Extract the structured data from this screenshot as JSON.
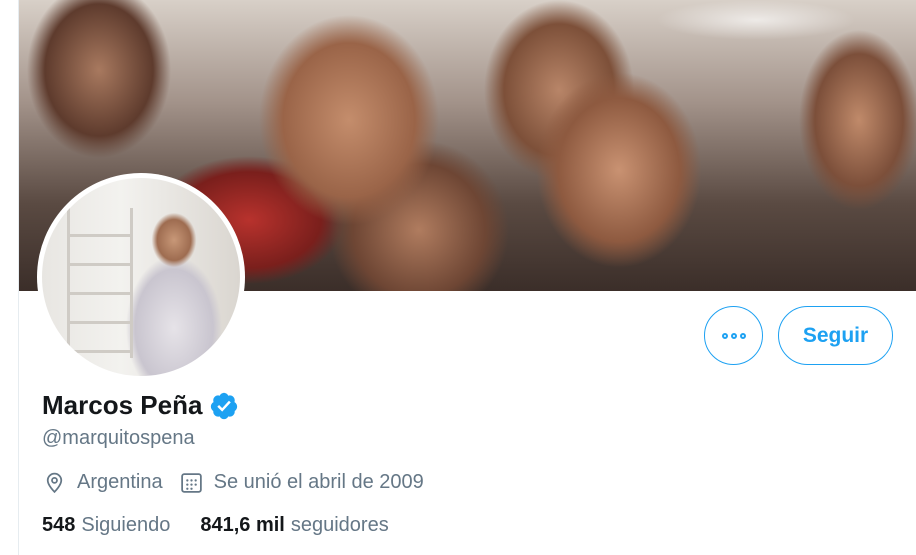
{
  "profile": {
    "name": "Marcos Peña",
    "handle": "@marquitospena",
    "location": "Argentina",
    "joined": "Se unió el abril de 2009",
    "verified": true
  },
  "actions": {
    "more_icon": "more-options-icon",
    "follow_label": "Seguir"
  },
  "stats": {
    "following_count": "548",
    "following_label": "Siguiendo",
    "followers_count": "841,6 mil",
    "followers_label": "seguidores"
  },
  "icons": {
    "location": "location-pin-icon",
    "calendar": "calendar-icon",
    "verified": "verified-badge-icon"
  },
  "colors": {
    "accent": "#1da1f2",
    "text": "#14171a",
    "muted": "#657786"
  }
}
